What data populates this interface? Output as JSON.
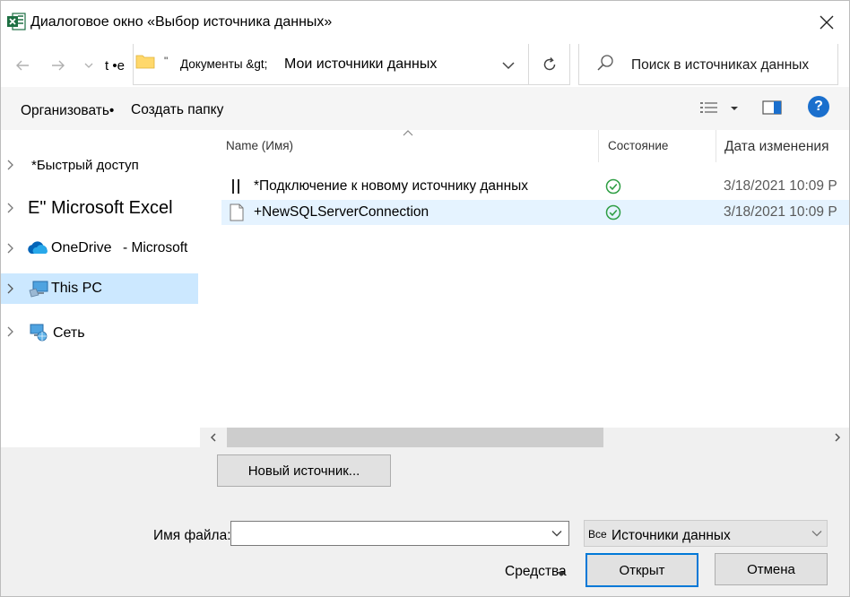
{
  "window": {
    "title": "Диалоговое окно «Выбор источника данных»",
    "app_icon": "excel-icon",
    "close_icon": "close-icon"
  },
  "address": {
    "up_text": "t •e",
    "quote_mark": "\"",
    "crumb_parent": "Документы &gt;",
    "crumb_current": "Мои источники данных",
    "search_placeholder": "Поиск в источниках данных"
  },
  "toolbar": {
    "organize": "Организовать•",
    "new_folder": "Создать папку"
  },
  "nav": {
    "items": [
      {
        "label": "*Быстрый доступ",
        "icon": "quick-access-icon"
      },
      {
        "label": "E\" Microsoft Excel",
        "icon": ""
      },
      {
        "label": "OneDrive",
        "suffix": "- Microsoft",
        "icon": "onedrive-cloud-icon"
      },
      {
        "label": "This PC",
        "icon": "this-pc-icon",
        "selected": true
      },
      {
        "label": "Сеть",
        "icon": "network-icon"
      }
    ]
  },
  "files": {
    "columns": {
      "name": "Name (Имя)",
      "status": "Состояние",
      "date": "Дата изменения"
    },
    "rows": [
      {
        "name": "*Подключение к новому источнику данных",
        "date": "3/18/2021 10:09 P",
        "icon": "pause-bars-icon",
        "status_icon": "check-circle-icon"
      },
      {
        "name": "+NewSQLServerConnection",
        "date": "3/18/2021 10:09 P",
        "icon": "document-icon",
        "status_icon": "check-circle-icon",
        "selected": true
      }
    ]
  },
  "bottom": {
    "new_source_button": "Новый источник...",
    "filename_label": "Имя файла:",
    "filename_value": "",
    "type_prefix": "Все",
    "type_value": "Источники данных",
    "tools": "Средства",
    "open_button": "Открыт",
    "cancel_button": "Отмена"
  },
  "colors": {
    "selection": "#cce8ff",
    "row_selection": "#e5f3ff",
    "accent": "#0078d7",
    "check": "#2e9e44",
    "excel_green": "#1d6f42"
  }
}
